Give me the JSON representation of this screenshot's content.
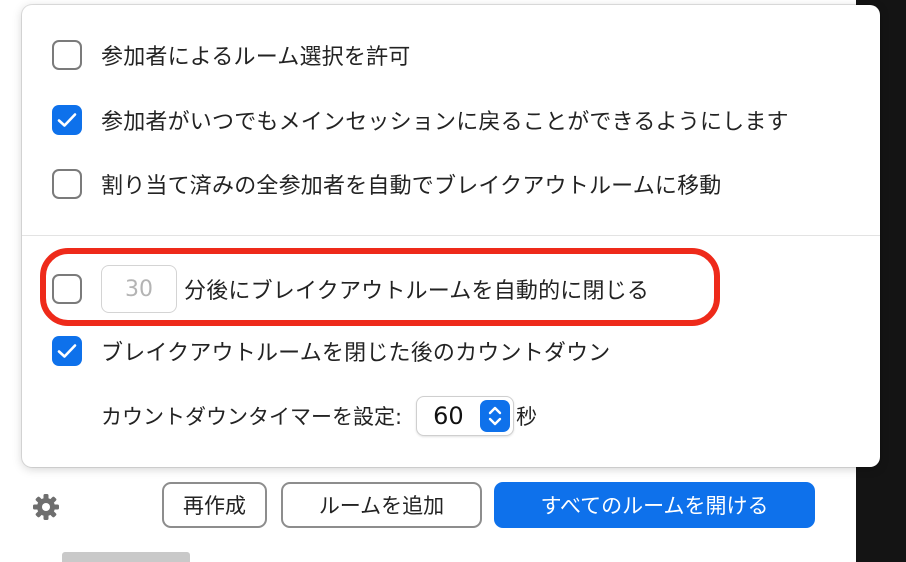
{
  "options": [
    {
      "label": "参加者によるルーム選択を許可",
      "checked": false
    },
    {
      "label": "参加者がいつでもメインセッションに戻ることができるようにします",
      "checked": true
    },
    {
      "label": "割り当て済みの全参加者を自動でブレイクアウトルームに移動",
      "checked": false
    }
  ],
  "auto_close": {
    "checked": false,
    "minutes_value": "30",
    "label": "分後にブレイクアウトルームを自動的に閉じる"
  },
  "countdown": {
    "checked": true,
    "label": "ブレイクアウトルームを閉じた後のカウントダウン",
    "timer_label": "カウントダウンタイマーを設定:",
    "timer_value": "60",
    "timer_unit": "秒"
  },
  "footer": {
    "recreate_label": "再作成",
    "add_room_label": "ルームを追加",
    "open_all_label": "すべてのルームを開ける"
  },
  "colors": {
    "accent": "#0e71eb",
    "highlight": "#ee2a1a"
  },
  "icons": {
    "settings": "gear-icon",
    "checkmark": "check-icon",
    "stepper": "up-down-chevron-icon"
  }
}
